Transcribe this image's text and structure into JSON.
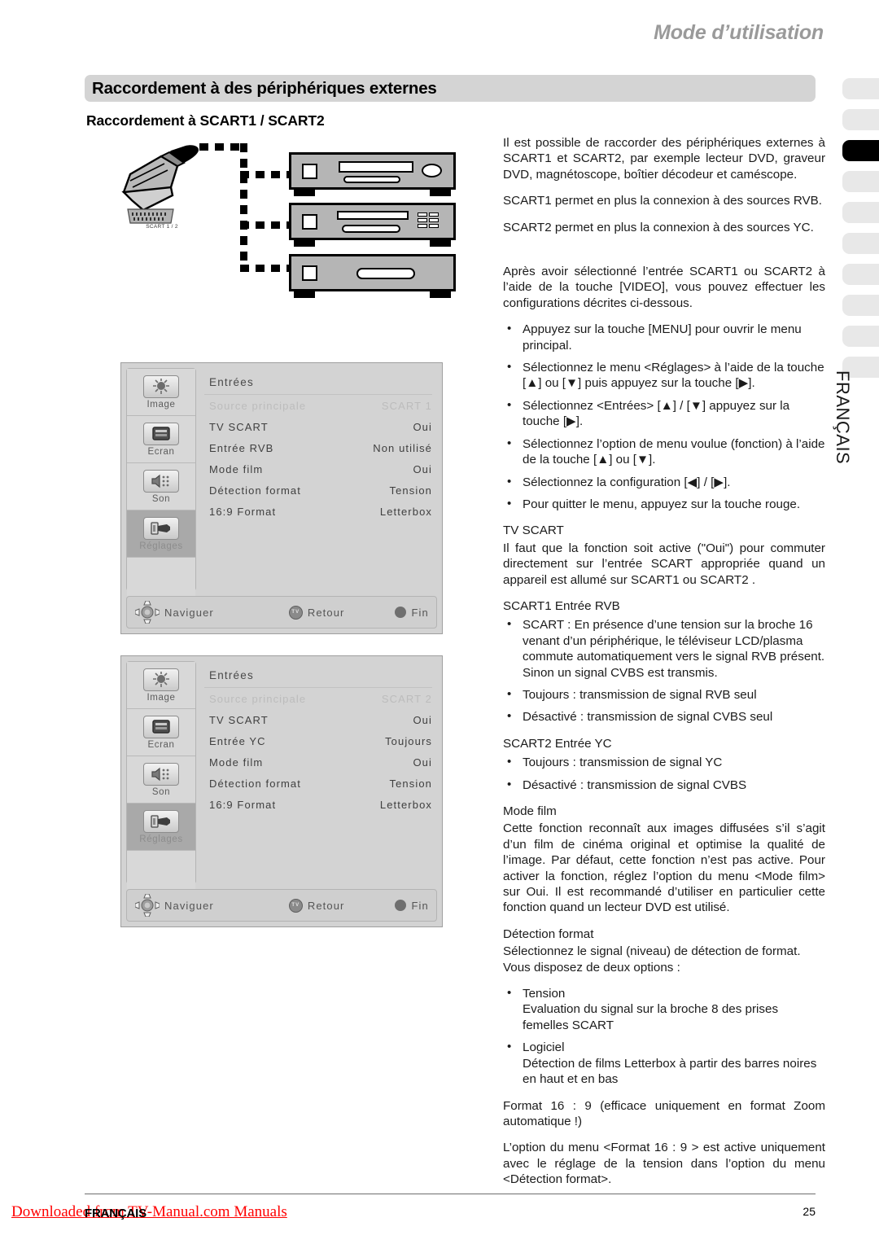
{
  "header": {
    "running_head": "Mode d’utilisation",
    "section_title": "Raccordement à des périphériques externes",
    "sub_title": "Raccordement à SCART1 / SCART2"
  },
  "side_tabs": {
    "count": 10,
    "active_index": 3,
    "language_label": "FRANÇAIS",
    "active_color": "#000000",
    "inactive_color": "#e8e8e8"
  },
  "diagram": {
    "connector_label": "SCART 1 / 2"
  },
  "osd": {
    "nav": {
      "navigate": "Naviguer",
      "back": "Retour",
      "back_icon_text": "TV",
      "end": "Fin"
    },
    "sidebar": [
      {
        "label": "Image",
        "icon": "sun-picture-icon",
        "selected": false
      },
      {
        "label": "Ecran",
        "icon": "screen-icon",
        "selected": false
      },
      {
        "label": "Son",
        "icon": "speaker-icon",
        "selected": false
      },
      {
        "label": "Réglages",
        "icon": "settings-plug-icon",
        "selected": true
      }
    ],
    "menu1": {
      "title": "Entrées",
      "rows": [
        {
          "label": "Source principale",
          "value": "SCART 1",
          "dim": true
        },
        {
          "label": "TV SCART",
          "value": "Oui",
          "dim": false
        },
        {
          "label": "Entrée RVB",
          "value": "Non utilisé",
          "dim": false
        },
        {
          "label": "Mode film",
          "value": "Oui",
          "dim": false
        },
        {
          "label": "Détection format",
          "value": "Tension",
          "dim": false
        },
        {
          "label": "16:9 Format",
          "value": "Letterbox",
          "dim": false
        }
      ]
    },
    "menu2": {
      "title": "Entrées",
      "rows": [
        {
          "label": "Source principale",
          "value": "SCART 2",
          "dim": true
        },
        {
          "label": "TV SCART",
          "value": "Oui",
          "dim": false
        },
        {
          "label": "Entrée YC",
          "value": "Toujours",
          "dim": false
        },
        {
          "label": "Mode film",
          "value": "Oui",
          "dim": false
        },
        {
          "label": "Détection format",
          "value": "Tension",
          "dim": false
        },
        {
          "label": "16:9 Format",
          "value": "Letterbox",
          "dim": false
        }
      ]
    }
  },
  "body": {
    "p_intro": "Il est possible de raccorder des périphériques externes à SCART1 et SCART2, par exemple lecteur DVD, graveur DVD, magnétoscope, boîtier décodeur et caméscope.",
    "p_scart1": "SCART1 permet en plus la connexion à des sources RVB.",
    "p_scart2": "SCART2 permet en plus la connexion à des sources YC.",
    "p_after": "Après avoir sélectionné l’entrée SCART1 ou SCART2 à l’aide de la touche [VIDEO], vous pouvez effectuer les configurations décrites ci-dessous.",
    "steps": [
      "Appuyez sur la touche [MENU] pour ouvrir le menu principal.",
      "Sélectionnez le menu <Réglages> à l’aide de la touche [▲] ou [▼] puis appuyez sur la touche [▶].",
      "Sélectionnez <Entrées> [▲] / [▼] appuyez sur la touche [▶].",
      "Sélectionnez l’option de menu voulue (fonction) à l’aide de la touche [▲] ou [▼].",
      "Sélectionnez la configuration [◀] / [▶].",
      "Pour quitter le menu, appuyez sur la touche rouge."
    ],
    "h_tvscart": "TV SCART",
    "p_tvscart": "Il faut que la fonction soit active (\"Oui\") pour commuter directement sur l’entrée SCART appropriée quand un appareil est allumé sur SCART1 ou SCART2 .",
    "h_scart1rvb": "SCART1 Entrée RVB",
    "list_scart1rvb": [
      "SCART : En présence d’une tension sur la broche 16 venant d’un périphérique, le téléviseur LCD/plasma commute automatiquement vers le signal RVB présent. Sinon un signal CVBS est transmis.",
      "Toujours : transmission de signal RVB seul",
      "Désactivé : transmission de signal CVBS seul"
    ],
    "h_scart2yc": "SCART2 Entrée YC",
    "list_scart2yc": [
      "Toujours : transmission de signal YC",
      "Désactivé : transmission de signal CVBS"
    ],
    "h_modefilm": "Mode film",
    "p_modefilm": "Cette fonction reconnaît aux images diffusées s’il s’agit d’un film de cinéma original et optimise la qualité de l’image. Par défaut, cette fonction n’est pas active. Pour activer la fonction, réglez l’option du menu <Mode film> sur Oui. Il est recommandé d’utiliser en particulier cette fonction quand un lecteur DVD est utilisé.",
    "h_detection": "Détection format",
    "p_detection": "Sélectionnez le signal (niveau) de détection de format. Vous disposez de deux options :",
    "opt_tension_title": "Tension",
    "opt_tension_desc": "Evaluation du signal sur la broche 8 des prises femelles SCART",
    "opt_logiciel_title": "Logiciel",
    "opt_logiciel_desc": "Détection de films Letterbox à partir des barres noires en haut et en bas",
    "p_format169": "Format 16 : 9 (efficace uniquement en format Zoom automatique !)",
    "p_format169b": "L’option du menu <Format 16 : 9 > est active uniquement avec le réglage de la tension dans l’option du menu <Détection format>."
  },
  "footer": {
    "language": "FRANÇAIS",
    "page_number": "25",
    "watermark": "Downloaded from TV-Manual.com Manuals",
    "watermark_color": "#ff0000"
  }
}
